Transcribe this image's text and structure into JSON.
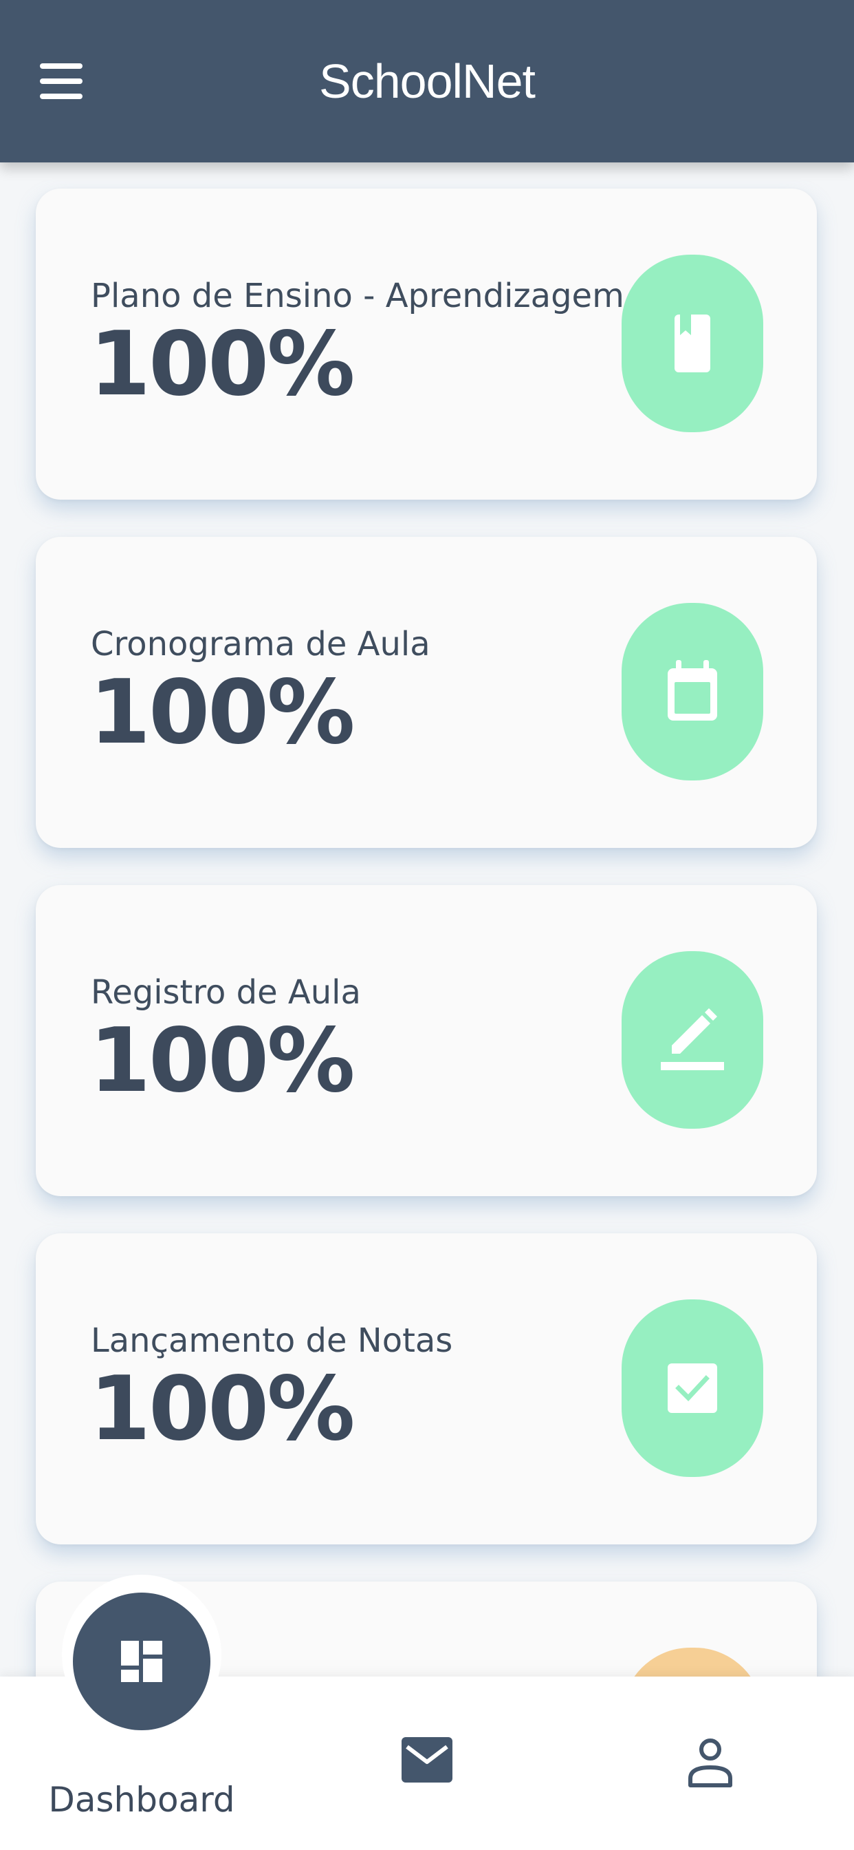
{
  "app_bar": {
    "title": "SchoolNet",
    "menu_icon": "hamburger-menu-icon"
  },
  "cards": [
    {
      "title": "Plano de Ensino - Aprendizagem",
      "value": "100%",
      "icon": "book-icon",
      "icon_bg": "#96efc1"
    },
    {
      "title": "Cronograma de Aula",
      "value": "100%",
      "icon": "calendar-icon",
      "icon_bg": "#96efc1"
    },
    {
      "title": "Registro de Aula",
      "value": "100%",
      "icon": "pencil-edit-icon",
      "icon_bg": "#96efc1"
    },
    {
      "title": "Lançamento de Notas",
      "value": "100%",
      "icon": "checkbox-icon",
      "icon_bg": "#96efc1"
    },
    {
      "icon_bg": "#f6cf95"
    }
  ],
  "bottom_nav": {
    "dashboard_label": "Dashboard",
    "dashboard_icon": "dashboard-grid-icon",
    "mail_icon": "mail-icon",
    "profile_icon": "user-profile-icon"
  },
  "colors": {
    "primary": "#44566c",
    "accent_green": "#96efc1",
    "accent_orange": "#f6cf95",
    "card_bg": "#fafafa",
    "text_dark": "#3d4a5c"
  }
}
